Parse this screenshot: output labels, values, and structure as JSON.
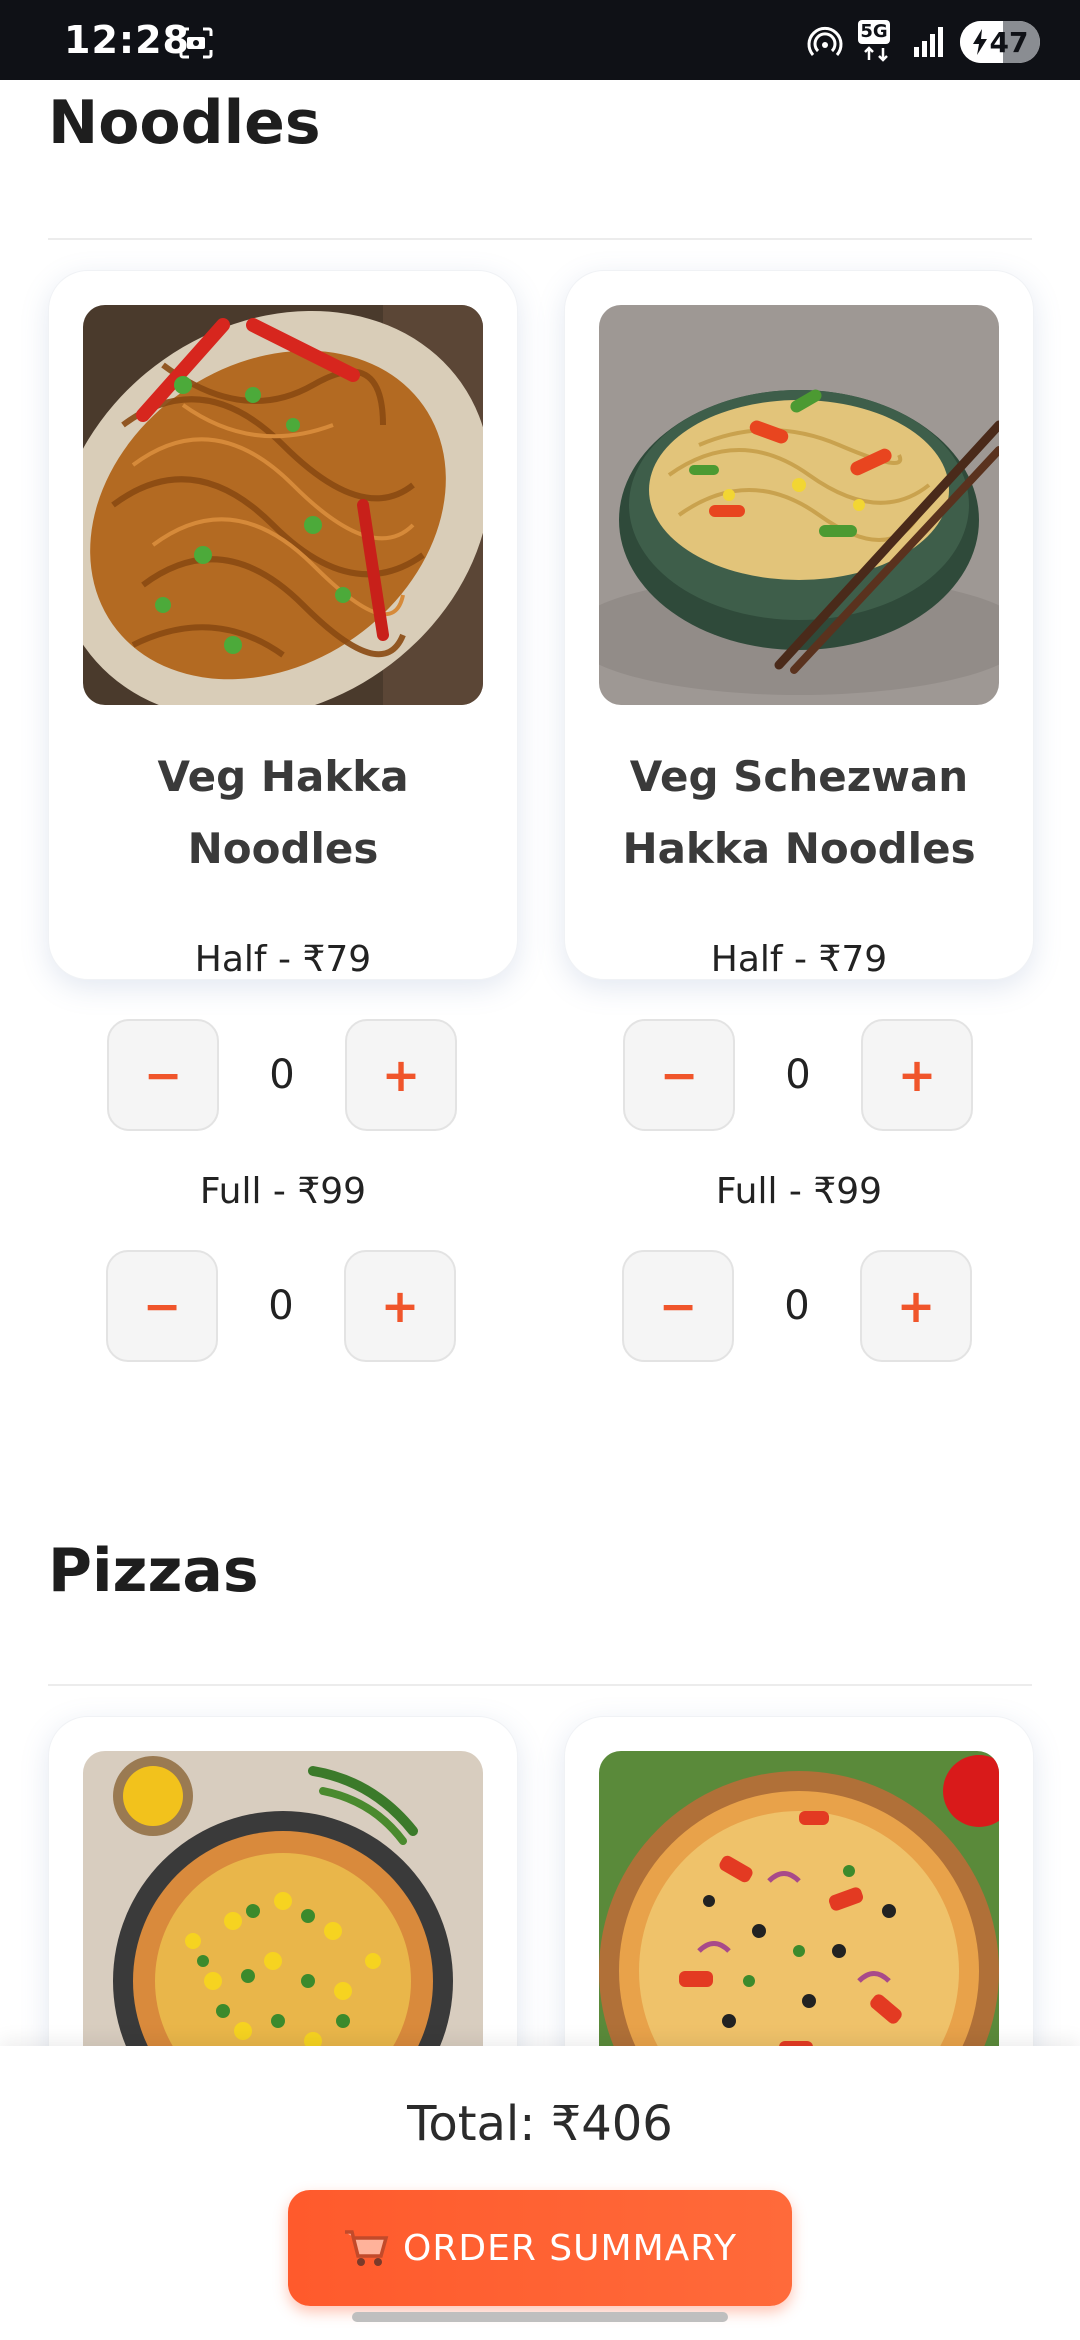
{
  "status_bar": {
    "time": "12:28",
    "network": "5G",
    "battery": "47"
  },
  "sections": [
    {
      "title": "Noodles",
      "items": [
        {
          "name_line1": "Veg Hakka",
          "name_line2": "Noodles",
          "half_price": "Half - ₹79",
          "half_qty": "0",
          "full_price": "Full - ₹99",
          "full_qty": "0"
        },
        {
          "name_line1": "Veg Schezwan",
          "name_line2": "Hakka Noodles",
          "half_price": "Half - ₹79",
          "half_qty": "0",
          "full_price": "Full - ₹99",
          "full_qty": "0"
        }
      ]
    },
    {
      "title": "Pizzas"
    }
  ],
  "stepper": {
    "minus": "−",
    "plus": "+"
  },
  "footer": {
    "total": "Total: ₹406",
    "order_label": "ORDER SUMMARY",
    "order_icon": "cart-icon"
  },
  "colors": {
    "accent": "#f0552b",
    "button": "#ff5a2c"
  }
}
